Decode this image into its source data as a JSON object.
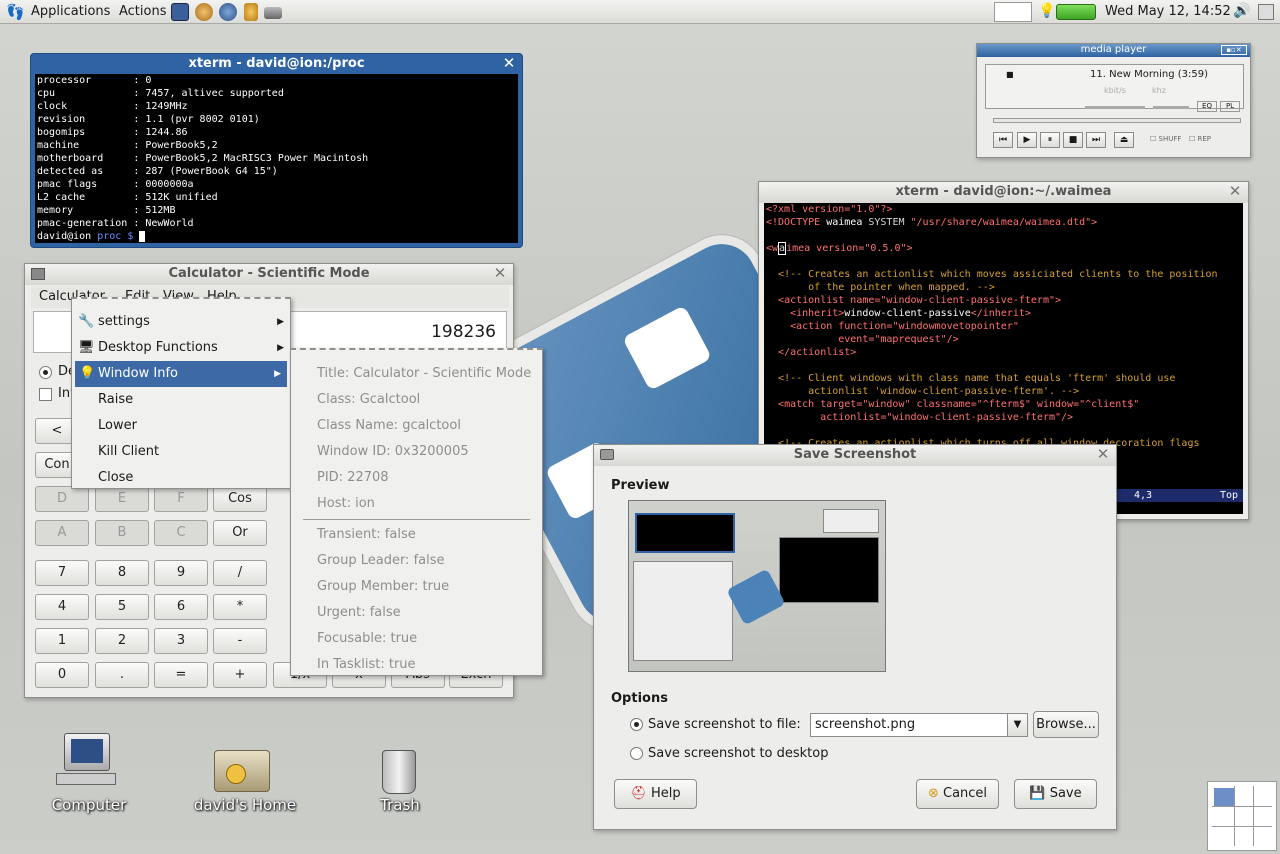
{
  "panel": {
    "applications": "Applications",
    "actions": "Actions",
    "clock": "Wed May 12, 14:52"
  },
  "xterm1": {
    "title": "xterm - david@ion:/proc",
    "lines": [
      "processor       : 0",
      "cpu             : 7457, altivec supported",
      "clock           : 1249MHz",
      "revision        : 1.1 (pvr 8002 0101)",
      "bogomips        : 1244.86",
      "machine         : PowerBook5,2",
      "motherboard     : PowerBook5,2 MacRISC3 Power Macintosh",
      "detected as     : 287 (PowerBook G4 15\")",
      "pmac flags      : 0000000a",
      "L2 cache        : 512K unified",
      "memory          : 512MB",
      "pmac-generation : NewWorld"
    ],
    "prompt_user": "david@ion",
    "prompt_dir": "proc $"
  },
  "media": {
    "title": "media player",
    "track": "11. New Morning (3:59)",
    "kbits": "kbit/s",
    "khz": "khz",
    "eq": "EQ",
    "pl": "PL",
    "shuff": "SHUFF",
    "rep": "REP"
  },
  "xterm2": {
    "title": "xterm - david@ion:~/.waimea",
    "status_pos": "4,3",
    "status_top": "Top"
  },
  "calc": {
    "title": "Calculator - Scientific Mode",
    "menu": [
      "Calculator",
      "Edit",
      "View",
      "Help"
    ],
    "display": "198236",
    "radio1": "De",
    "check1": "Inv",
    "rowA": [
      "D",
      "E",
      "F",
      "Cos"
    ],
    "rowB": [
      "A",
      "B",
      "C",
      "Or"
    ],
    "rowC": [
      "7",
      "8",
      "9",
      "/"
    ],
    "rowD": [
      "4",
      "5",
      "6",
      "*"
    ],
    "rowE": [
      "1",
      "2",
      "3",
      "-"
    ],
    "rowF": [
      "0",
      ".",
      "=",
      "+",
      "1/x",
      "x",
      "Abs",
      "Exch"
    ],
    "lt": "<",
    "con": "Con"
  },
  "menu": {
    "settings": "settings",
    "desktop_functions": "Desktop Functions",
    "window_info": "Window Info",
    "raise": "Raise",
    "lower": "Lower",
    "kill": "Kill Client",
    "close": "Close"
  },
  "info": [
    "Title: Calculator - Scientific Mode",
    "Class: Gcalctool",
    "Class Name: gcalctool",
    "Window ID: 0x3200005",
    "PID: 22708",
    "Host: ion"
  ],
  "info2": [
    "Transient: false",
    "Group Leader: false",
    "Group Member: true",
    "Urgent: false",
    "Focusable: true",
    "In Tasklist: true"
  ],
  "shot": {
    "title": "Save Screenshot",
    "preview": "Preview",
    "options": "Options",
    "opt_file": "Save screenshot to file:",
    "filename": "screenshot.png",
    "browse": "Browse...",
    "opt_desktop": "Save screenshot to desktop",
    "help": "Help",
    "cancel": "Cancel",
    "save": "Save"
  },
  "desktop": {
    "computer": "Computer",
    "home": "david's Home",
    "trash": "Trash"
  }
}
